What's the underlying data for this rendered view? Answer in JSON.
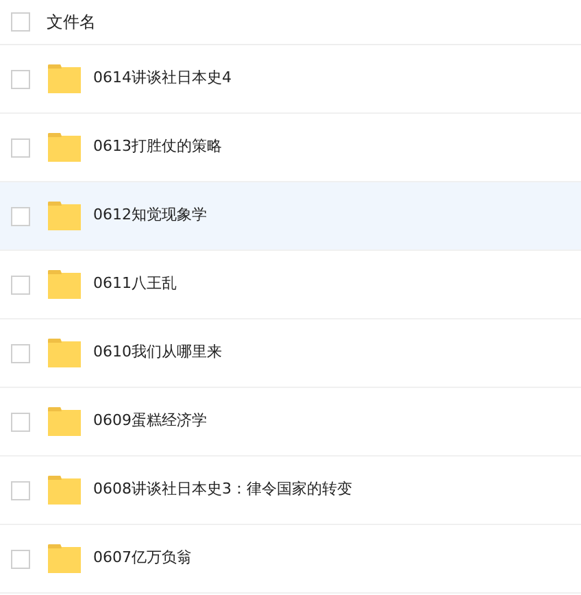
{
  "header": {
    "label": "文件名",
    "checked": false
  },
  "files": [
    {
      "name": "0614讲谈社日本史4",
      "checked": false,
      "hovered": false
    },
    {
      "name": "0613打胜仗的策略",
      "checked": false,
      "hovered": false
    },
    {
      "name": "0612知觉现象学",
      "checked": false,
      "hovered": true
    },
    {
      "name": "0611八王乱",
      "checked": false,
      "hovered": false
    },
    {
      "name": "0610我们从哪里来",
      "checked": false,
      "hovered": false
    },
    {
      "name": "0609蛋糕经济学",
      "checked": false,
      "hovered": false
    },
    {
      "name": "0608讲谈社日本史3：律令国家的转变",
      "checked": false,
      "hovered": false
    },
    {
      "name": "0607亿万负翁",
      "checked": false,
      "hovered": false
    }
  ]
}
